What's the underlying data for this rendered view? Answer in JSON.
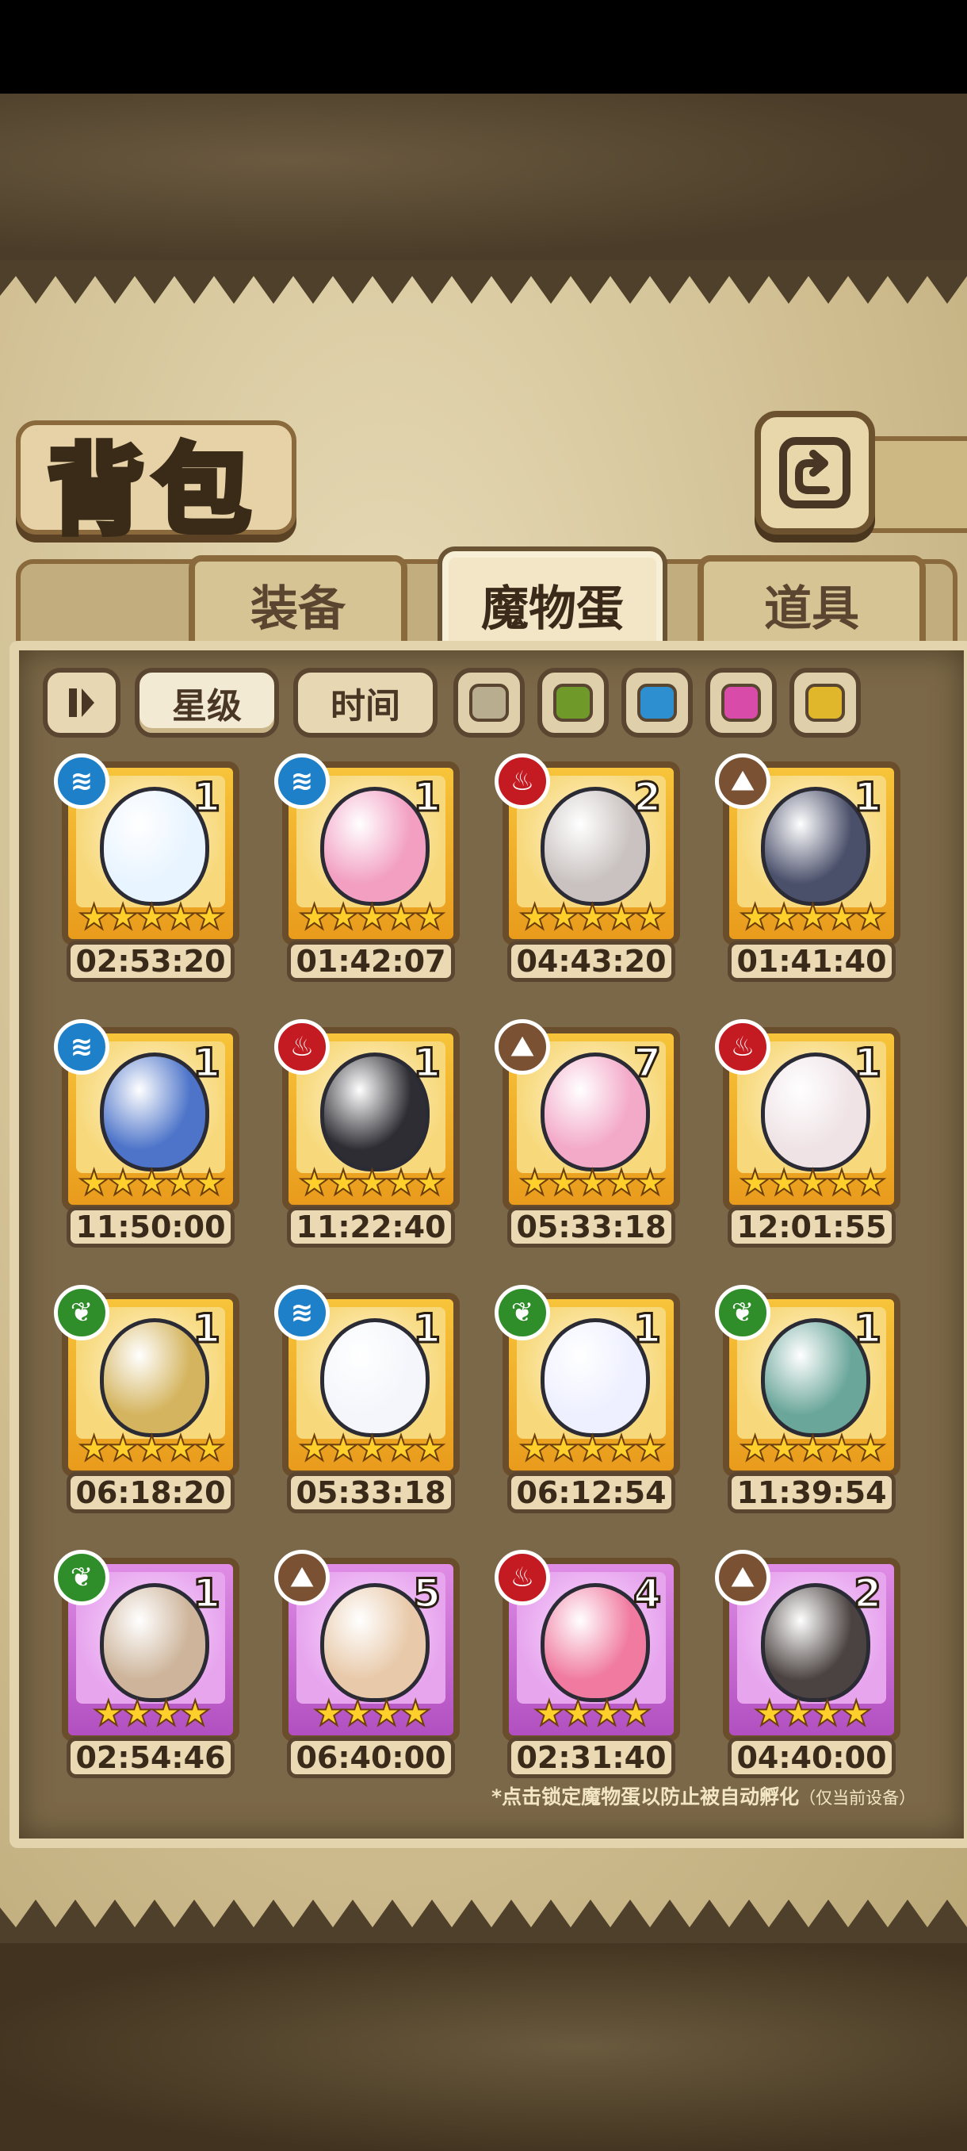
{
  "title": "背包",
  "tabs": [
    {
      "label": "装备",
      "active": false
    },
    {
      "label": "魔物蛋",
      "active": true
    },
    {
      "label": "道具",
      "active": false
    }
  ],
  "sort": {
    "pause_icon": "pause-icon",
    "star_label": "星级",
    "time_label": "时间",
    "star_selected": true
  },
  "color_filters": [
    "#b9ad8f",
    "#6f9a2a",
    "#2d8fd0",
    "#d94ba8",
    "#e0b62a"
  ],
  "eggs": [
    {
      "element": "water",
      "count": "1",
      "stars": "★★★★★",
      "timer": "02:53:20",
      "frame": "gold",
      "color": "#e8f4ff"
    },
    {
      "element": "water",
      "count": "1",
      "stars": "★★★★★",
      "timer": "01:42:07",
      "frame": "gold",
      "color": "#f29fc2"
    },
    {
      "element": "fire",
      "count": "2",
      "stars": "★★★★★",
      "timer": "04:43:20",
      "frame": "gold",
      "color": "#c9c2c0"
    },
    {
      "element": "earth",
      "count": "1",
      "stars": "★★★★★",
      "timer": "01:41:40",
      "frame": "gold",
      "color": "#4a4f6a"
    },
    {
      "element": "water",
      "count": "1",
      "stars": "★★★★★",
      "timer": "11:50:00",
      "frame": "gold",
      "color": "#4d74c9"
    },
    {
      "element": "fire",
      "count": "1",
      "stars": "★★★★★",
      "timer": "11:22:40",
      "frame": "gold",
      "color": "#2e2d33"
    },
    {
      "element": "earth",
      "count": "7",
      "stars": "★★★★★",
      "timer": "05:33:18",
      "frame": "gold",
      "color": "#f3a9c8"
    },
    {
      "element": "fire",
      "count": "1",
      "stars": "★★★★★",
      "timer": "12:01:55",
      "frame": "gold",
      "color": "#efe3e6"
    },
    {
      "element": "grass",
      "count": "1",
      "stars": "★★★★★",
      "timer": "06:18:20",
      "frame": "gold",
      "color": "#d4b45e"
    },
    {
      "element": "water",
      "count": "1",
      "stars": "★★★★★",
      "timer": "05:33:18",
      "frame": "gold",
      "color": "#f4f6fb"
    },
    {
      "element": "grass",
      "count": "1",
      "stars": "★★★★★",
      "timer": "06:12:54",
      "frame": "gold",
      "color": "#eef0ff"
    },
    {
      "element": "grass",
      "count": "1",
      "stars": "★★★★★",
      "timer": "11:39:54",
      "frame": "gold",
      "color": "#6aa69a"
    },
    {
      "element": "grass",
      "count": "1",
      "stars": "★★★★",
      "timer": "02:54:46",
      "frame": "purple",
      "color": "#cdb49a"
    },
    {
      "element": "earth",
      "count": "5",
      "stars": "★★★★",
      "timer": "06:40:00",
      "frame": "purple",
      "color": "#e8c9a9"
    },
    {
      "element": "fire",
      "count": "4",
      "stars": "★★★★",
      "timer": "02:31:40",
      "frame": "purple",
      "color": "#f07aa0"
    },
    {
      "element": "earth",
      "count": "2",
      "stars": "★★★★",
      "timer": "04:40:00",
      "frame": "purple",
      "color": "#4b4341"
    }
  ],
  "footnote": {
    "main": "*点击锁定魔物蛋以防止被自动孵化",
    "sub": "（仅当前设备）"
  },
  "icons": {
    "back": "back-arrow-icon",
    "water": "water-icon",
    "fire": "fire-icon",
    "earth": "earth-icon",
    "grass": "leaf-icon"
  }
}
